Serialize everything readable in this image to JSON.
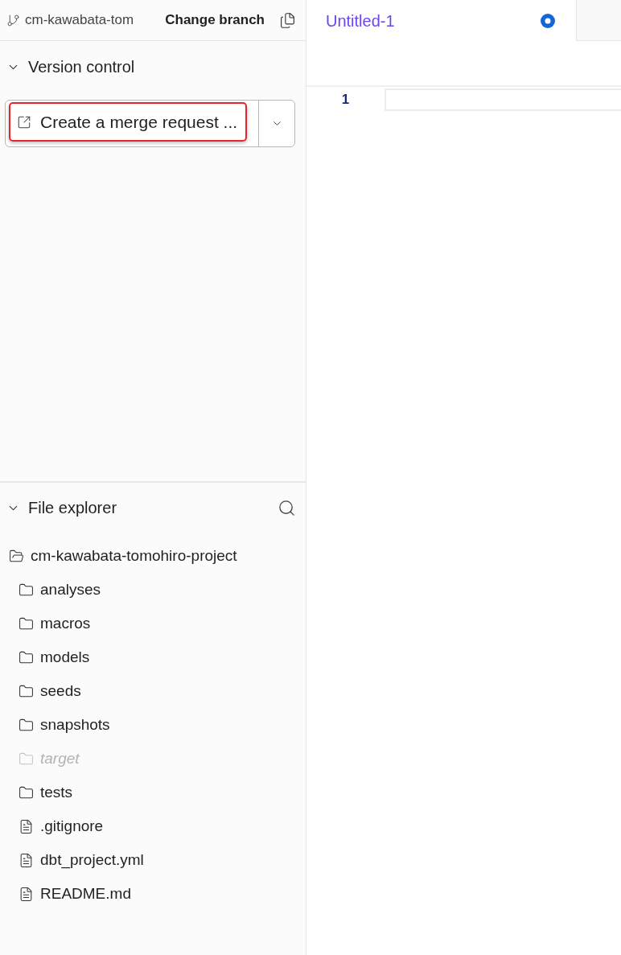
{
  "branch_bar": {
    "branch_name": "cm-kawabata-tom",
    "change_branch_label": "Change branch"
  },
  "version_control": {
    "title": "Version control",
    "expanded": true,
    "merge_button": {
      "label": "Create a merge request ...",
      "highlighted": true
    }
  },
  "file_explorer": {
    "title": "File explorer",
    "expanded": true,
    "tree": [
      {
        "name": "cm-kawabata-tomohiro-project",
        "kind": "folder",
        "expanded": true,
        "ignored": false,
        "children": [
          {
            "name": "analyses",
            "kind": "folder",
            "expanded": false,
            "ignored": false
          },
          {
            "name": "macros",
            "kind": "folder",
            "expanded": false,
            "ignored": false
          },
          {
            "name": "models",
            "kind": "folder",
            "expanded": false,
            "ignored": false
          },
          {
            "name": "seeds",
            "kind": "folder",
            "expanded": false,
            "ignored": false
          },
          {
            "name": "snapshots",
            "kind": "folder",
            "expanded": false,
            "ignored": false
          },
          {
            "name": "target",
            "kind": "folder",
            "expanded": false,
            "ignored": true
          },
          {
            "name": "tests",
            "kind": "folder",
            "expanded": false,
            "ignored": false
          },
          {
            "name": ".gitignore",
            "kind": "file",
            "ignored": false
          },
          {
            "name": "dbt_project.yml",
            "kind": "file",
            "ignored": false
          },
          {
            "name": "README.md",
            "kind": "file",
            "ignored": false
          }
        ]
      }
    ]
  },
  "editor": {
    "tabs": [
      {
        "label": "Untitled-1",
        "selected": true,
        "modified": true
      }
    ],
    "line_numbers": [
      "1"
    ]
  }
}
